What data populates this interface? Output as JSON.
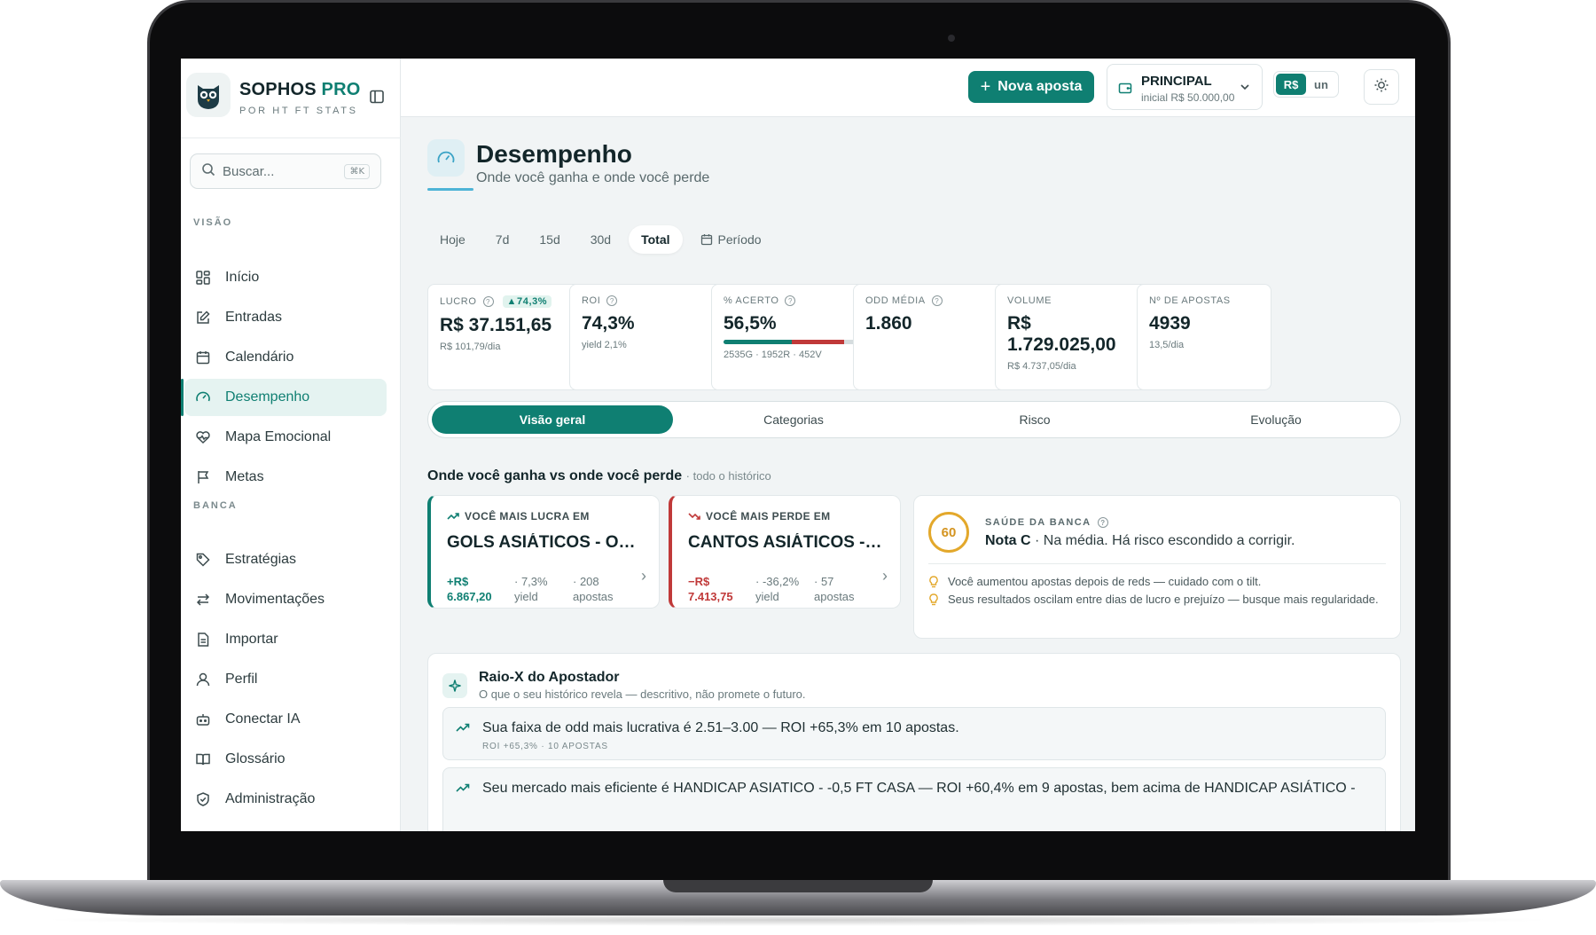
{
  "brand": {
    "name": "SOPHOS",
    "suffix": "PRO",
    "subtitle": "POR HT FT STATS"
  },
  "search": {
    "placeholder": "Buscar...",
    "shortcut": "⌘K"
  },
  "sidebar": {
    "sections": [
      {
        "title": "VISÃO",
        "items": [
          {
            "label": "Início",
            "icon": "grid-icon"
          },
          {
            "label": "Entradas",
            "icon": "edit-icon"
          },
          {
            "label": "Calendário",
            "icon": "calendar-icon"
          },
          {
            "label": "Desempenho",
            "icon": "gauge-icon",
            "active": true
          },
          {
            "label": "Mapa Emocional",
            "icon": "heart-pulse-icon"
          },
          {
            "label": "Metas",
            "icon": "flag-icon"
          }
        ]
      },
      {
        "title": "BANCA",
        "items": [
          {
            "label": "Estratégias",
            "icon": "tag-icon"
          },
          {
            "label": "Movimentações",
            "icon": "arrows-icon"
          },
          {
            "label": "Importar",
            "icon": "file-icon"
          },
          {
            "label": "Perfil",
            "icon": "user-icon"
          },
          {
            "label": "Conectar IA",
            "icon": "bot-icon"
          },
          {
            "label": "Glossário",
            "icon": "book-icon"
          },
          {
            "label": "Administração",
            "icon": "shield-icon"
          }
        ]
      }
    ]
  },
  "topbar": {
    "new_bet_label": "Nova aposta",
    "bank_name": "PRINCIPAL",
    "bank_initial": "inicial R$ 50.000,00",
    "currency_options": [
      "R$",
      "un"
    ],
    "currency_selected": "R$"
  },
  "page": {
    "title": "Desempenho",
    "subtitle": "Onde você ganha e onde você perde"
  },
  "range_tabs": [
    "Hoje",
    "7d",
    "15d",
    "30d",
    "Total"
  ],
  "range_selected": "Total",
  "period_label": "Período",
  "stats": {
    "lucro": {
      "label": "LUCRO",
      "badge": "▲74,3%",
      "value": "R$ 37.151,65",
      "sub": "R$ 101,79/dia"
    },
    "roi": {
      "label": "ROI",
      "value": "74,3%",
      "sub": "yield 2,1%"
    },
    "acerto": {
      "label": "% ACERTO",
      "value": "56,5%",
      "sub": "2535G · 1952R · 452V",
      "green": 2535,
      "red": 1952,
      "void": 452
    },
    "odd": {
      "label": "ODD MÉDIA",
      "value": "1.860"
    },
    "volume": {
      "label": "VOLUME",
      "value_line1": "R$",
      "value_line2": "1.729.025,00",
      "sub": "R$ 4.737,05/dia"
    },
    "apostas": {
      "label": "Nº DE APOSTAS",
      "value": "4939",
      "sub": "13,5/dia"
    }
  },
  "subtabs": [
    "Visão geral",
    "Categorias",
    "Risco",
    "Evolução"
  ],
  "subtab_selected": "Visão geral",
  "win_lose": {
    "title": "Onde você ganha vs onde você perde",
    "scope": "· todo o histórico",
    "win": {
      "head": "VOCÊ MAIS LUCRA EM",
      "name": "GOLS ASIÁTICOS - OVER",
      "amount_1": "+R$",
      "amount_2": "6.867,20",
      "yield_1": "· 7,3%",
      "yield_2": "yield",
      "bets_1": "· 208",
      "bets_2": "apostas"
    },
    "lose": {
      "head": "VOCÊ MAIS PERDE EM",
      "name": "CANTOS ASIÁTICOS - OVER",
      "amount_1": "−R$",
      "amount_2": "7.413,75",
      "yield_1": "· -36,2%",
      "yield_2": "yield",
      "bets_1": "· 57",
      "bets_2": "apostas"
    }
  },
  "health": {
    "score": "60",
    "label": "SAÚDE DA BANCA",
    "grade": "Nota C",
    "grade_text": " · Na média. Há risco escondido a corrigir.",
    "tips": [
      "Você aumentou apostas depois de reds — cuidado com o tilt.",
      "Seus resultados oscilam entre dias de lucro e prejuízo — busque mais regularidade."
    ]
  },
  "xray": {
    "title": "Raio-X do Apostador",
    "subtitle": "O que o seu histórico revela — descritivo, não promete o futuro.",
    "insights": [
      {
        "text": "Sua faixa de odd mais lucrativa é 2.51–3.00 — ROI +65,3% em 10 apostas.",
        "meta": "ROI +65,3% · 10 APOSTAS"
      },
      {
        "text": "Seu mercado mais eficiente é HANDICAP ASIATICO - -0,5 FT CASA — ROI +60,4% em 9 apostas, bem acima de HANDICAP ASIÁTICO -",
        "meta": ""
      }
    ]
  },
  "colors": {
    "accent": "#0f7f72",
    "loss": "#c03939",
    "warning": "#e3a82b"
  }
}
